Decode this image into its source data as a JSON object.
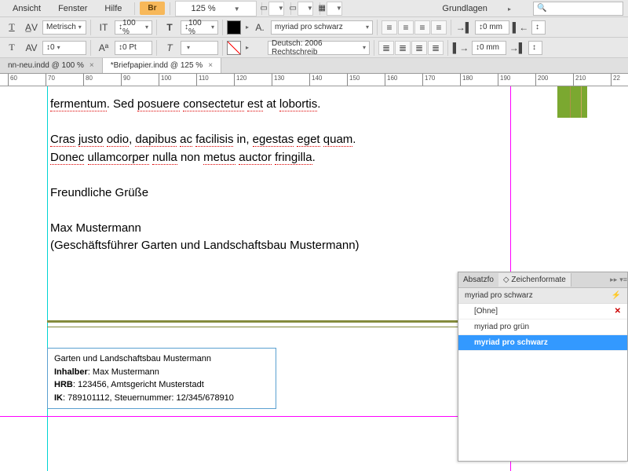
{
  "menu": {
    "view": "Ansicht",
    "window": "Fenster",
    "help": "Hilfe",
    "br": "Br",
    "zoom": "125 %",
    "workspace": "Grundlagen"
  },
  "tb": {
    "metric": "Metrisch",
    "pct1": "100 %",
    "pct2": "100 %",
    "font_style": "myriad pro schwarz",
    "lang": "Deutsch: 2006 Rechtschreib",
    "kern": "0",
    "baseline": "0 Pt",
    "mm0a": "0 mm",
    "mm0b": "0 mm",
    "num0": "0"
  },
  "tabs": {
    "t1": "nn-neu.indd @ 100 %",
    "t2": "*Briefpapier.indd @ 125 %"
  },
  "ruler": [
    "60",
    "70",
    "80",
    "90",
    "100",
    "110",
    "120",
    "130",
    "140",
    "150",
    "160",
    "170",
    "180",
    "190",
    "200",
    "210",
    "22"
  ],
  "doc": {
    "l1a": "fermentum",
    "l1b": ". Sed ",
    "l1c": "posuere",
    "l1d": " ",
    "l1e": "consectetur",
    "l1f": " ",
    "l1g": "est",
    "l1h": " at ",
    "l1i": "lobortis",
    "l1j": ".",
    "l2a": "Cras",
    "l2b": " ",
    "l2c": "justo",
    "l2d": " ",
    "l2e": "odio",
    "l2f": ", ",
    "l2g": "dapibus",
    "l2h": " ",
    "l2i": "ac",
    "l2j": " ",
    "l2k": "facilisis",
    "l2l": " in, ",
    "l2m": "egestas",
    "l2n": " ",
    "l2o": "eget",
    "l2p": " ",
    "l2q": "quam",
    "l2r": ".",
    "l3a": "Donec",
    "l3b": " ",
    "l3c": "ullamcorper",
    "l3d": " ",
    "l3e": "nulla",
    "l3f": " non ",
    "l3g": "metus",
    "l3h": " ",
    "l3i": "auctor",
    "l3j": " ",
    "l3k": "fringilla",
    "l3l": ".",
    "l4": "Freundliche Grüße",
    "l5": "Max Mustermann",
    "l6": "(Geschäftsführer Garten und Landschaftsbau Mustermann)"
  },
  "footer": {
    "f1": "Garten und Landschaftsbau Mustermann",
    "f2a": "Inhalber",
    "f2b": ": Max Mustermann",
    "f3a": "HRB",
    "f3b": ": 123456, Amtsgericht Musterstadt",
    "f4a": "IK",
    "f4b": ": 789101112, Steuernummer: 12/345/678910"
  },
  "panel": {
    "tab1": "Absatzfo",
    "tab2": "Zeichenformate",
    "current": "myriad pro schwarz",
    "none": "[Ohne]",
    "item1": "myriad pro grün",
    "item2": "myriad pro schwarz"
  }
}
